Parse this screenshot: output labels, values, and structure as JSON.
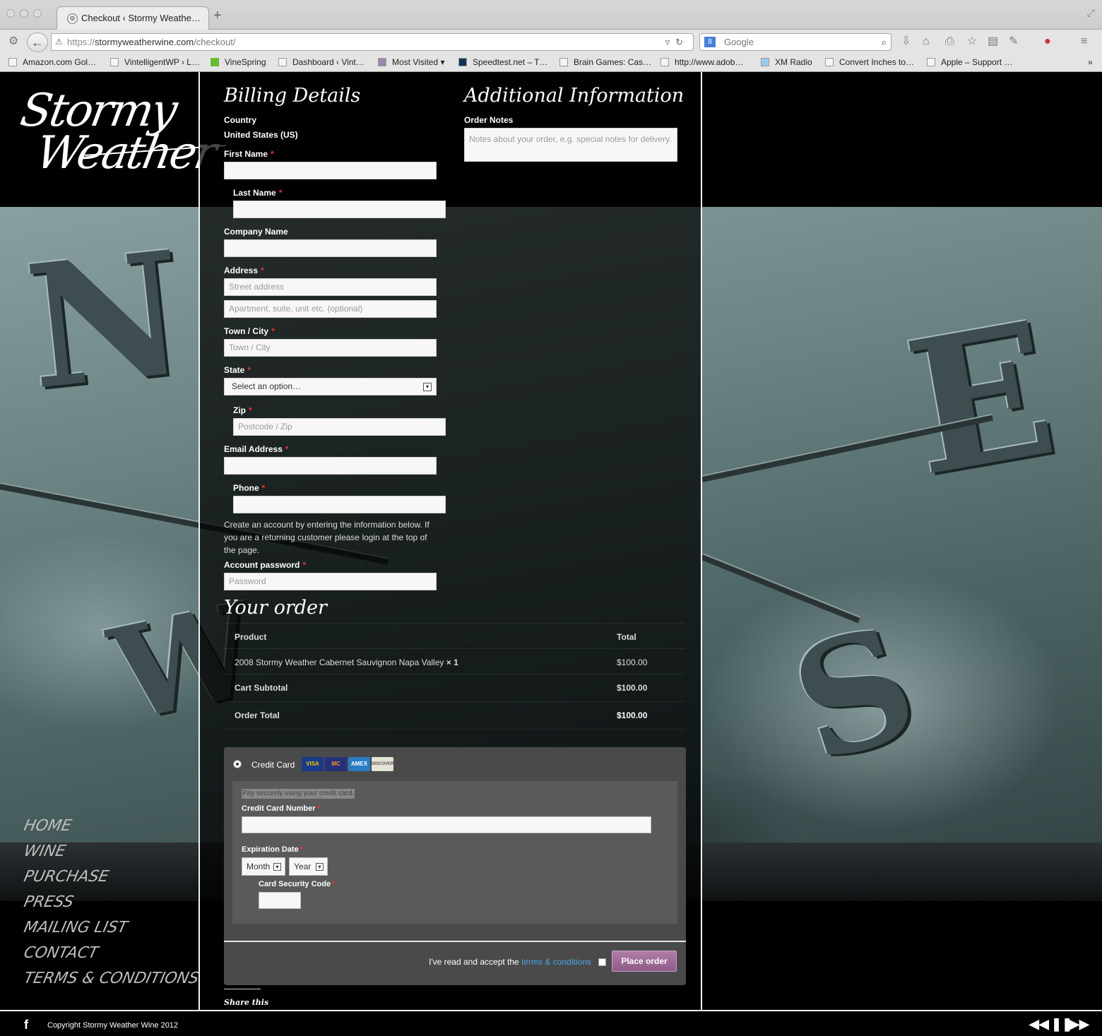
{
  "browser": {
    "tab_title": "Checkout ‹ Stormy Weathe…",
    "url_protocol": "https://",
    "url_domain": "stormyweatherwine.com",
    "url_path": "/checkout/",
    "search_placeholder": "Google",
    "bookmarks": [
      "Amazon.com Gol…",
      "VintelligentWP › L…",
      "VineSpring",
      "Dashboard ‹ Vint…",
      "Most Visited",
      "Speedtest.net – T…",
      "Brain Games: Cas…",
      "http://www.adob…",
      "XM Radio",
      "Convert Inches to…",
      "Apple – Support …"
    ]
  },
  "logo": {
    "line1": "Stormy",
    "line2": "Weather"
  },
  "nav": [
    "Home",
    "Wine",
    "Purchase",
    "Press",
    "Mailing List",
    "Contact",
    "Terms & Conditions"
  ],
  "billing": {
    "heading": "Billing Details",
    "country_label": "Country",
    "country_value": "United States (US)",
    "first_name_label": "First Name",
    "last_name_label": "Last Name",
    "company_label": "Company Name",
    "address_label": "Address",
    "street_placeholder": "Street address",
    "apt_placeholder": "Apartment, suite, unit etc. (optional)",
    "city_label": "Town / City",
    "city_placeholder": "Town / City",
    "state_label": "State",
    "state_value": "Select an option…",
    "zip_label": "Zip",
    "zip_placeholder": "Postcode / Zip",
    "email_label": "Email Address",
    "phone_label": "Phone",
    "account_text": "Create an account by entering the information below. If you are a returning customer please login at the top of the page.",
    "password_label": "Account password",
    "password_placeholder": "Password",
    "required_mark": "*"
  },
  "additional": {
    "heading": "Additional Information",
    "notes_label": "Order Notes",
    "notes_placeholder": "Notes about your order, e.g. special notes for delivery."
  },
  "order": {
    "heading": "Your order",
    "col_product": "Product",
    "col_total": "Total",
    "item_name": "2008 Stormy Weather Cabernet Sauvignon Napa Valley",
    "item_qty": "× 1",
    "item_total": "$100.00",
    "subtotal_label": "Cart Subtotal",
    "subtotal_value": "$100.00",
    "total_label": "Order Total",
    "total_value": "$100.00"
  },
  "payment": {
    "method_label": "Credit Card",
    "cards": [
      "VISA",
      "MC",
      "AMEX",
      "DISCOVER"
    ],
    "note": "Pay securely using your credit card.",
    "card_number_label": "Credit Card Number",
    "expiration_label": "Expiration Date",
    "month_value": "Month",
    "year_value": "Year",
    "security_label": "Card Security Code",
    "terms_text": "I've read and accept the",
    "terms_link": "terms & conditions",
    "place_order": "Place order"
  },
  "share": "Share this",
  "footer": {
    "copyright": "Copyright Stormy Weather Wine 2012"
  },
  "colors": {
    "accent_link": "#4aa6e8",
    "place_order": "#9e6a96",
    "required": "#e33333"
  }
}
